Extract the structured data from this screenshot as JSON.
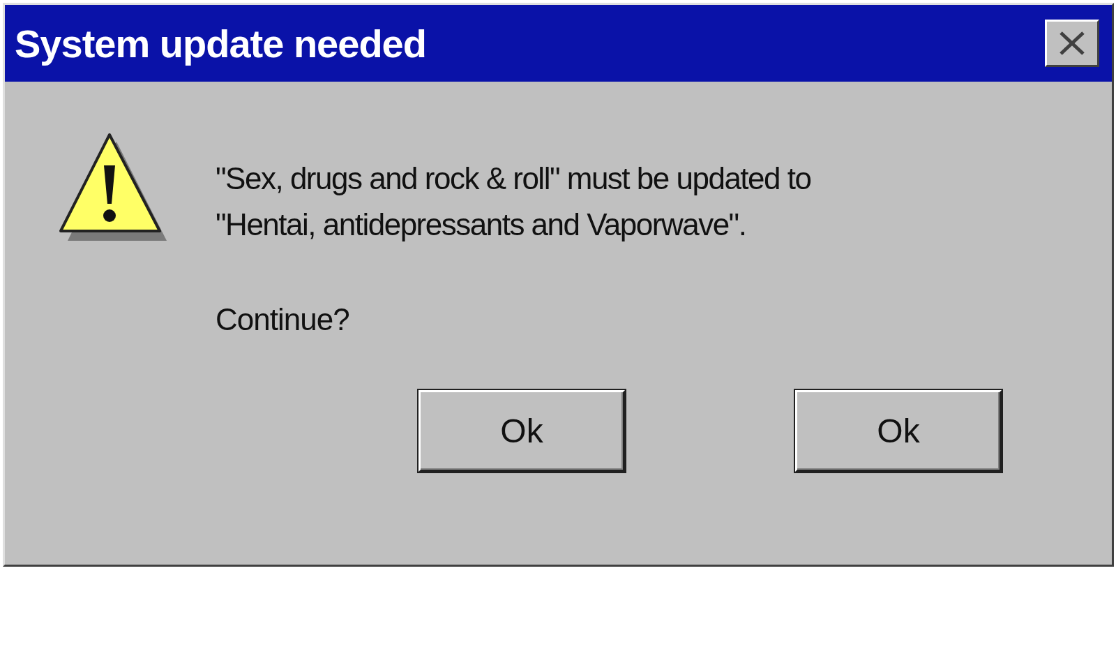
{
  "window": {
    "title": "System update needed"
  },
  "message": "\"Sex, drugs and rock & roll\" must be updated to\n\"Hentai, antidepressants and Vaporwave\".",
  "prompt": "Continue?",
  "buttons": [
    "Ok",
    "Ok"
  ]
}
